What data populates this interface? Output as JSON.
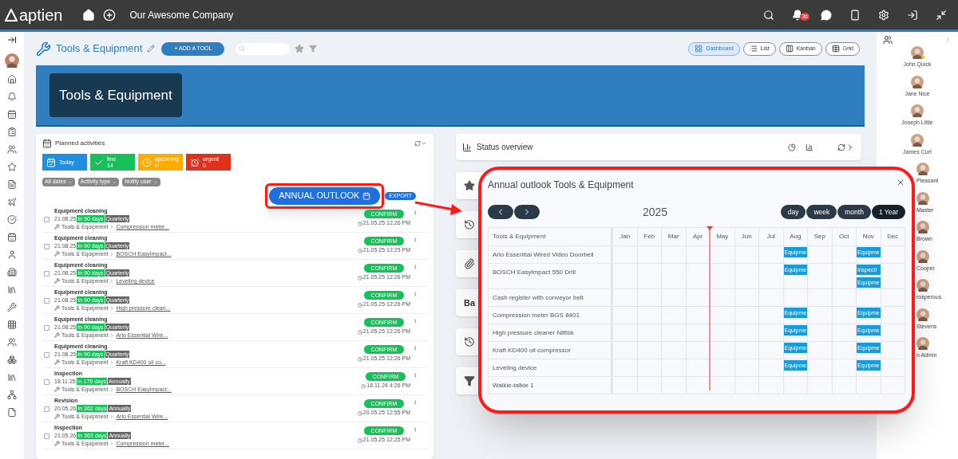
{
  "topbar": {
    "logo": "aptien",
    "company": "Our Awesome Company",
    "notifications": "36"
  },
  "header": {
    "title": "Tools & Equipment",
    "add_button": "+ ADD A TOOL",
    "views": [
      {
        "label": "Dashboard",
        "kind": "dashboard",
        "selected": true
      },
      {
        "label": "List",
        "kind": "list",
        "selected": false
      },
      {
        "label": "Kanban",
        "kind": "kanban",
        "selected": false
      },
      {
        "label": "Grid",
        "kind": "grid",
        "selected": false
      }
    ]
  },
  "banner": {
    "title": "Tools & Equipment"
  },
  "planned": {
    "title": "Planned activities",
    "tiles": [
      {
        "kind": "today",
        "label": "Today",
        "color": "#1e8fe1"
      },
      {
        "kind": "fine",
        "label": "fine",
        "count": "14",
        "color": "#16c15a"
      },
      {
        "kind": "upcoming",
        "label": "upcoming",
        "count": "0",
        "color": "#ffab00"
      },
      {
        "kind": "urgent",
        "label": "urgent",
        "count": "0",
        "color": "#e0301e"
      }
    ],
    "filters": [
      "All dates",
      "Activity type",
      "Notify user"
    ],
    "annual_button": "ANNUAL OUTLOOK",
    "export_button": "EXPORT",
    "activities": [
      {
        "title": "Equipment cleaning",
        "date": "21.08.25",
        "due": "In 90 days",
        "repeat": "Quarterly",
        "module": "Tools & Equipment",
        "item": "Compression meter...",
        "confirm": "CONFIRM",
        "stamp": "21.05.25 12:26 PM",
        "checked": false
      },
      {
        "title": "Equipment cleaning",
        "date": "21.08.25",
        "due": "In 90 days",
        "repeat": "Quarterly",
        "module": "Tools & Equipment",
        "item": "BOSCH EasyImpact...",
        "confirm": "CONFIRM",
        "stamp": "21.05.25 12:25 PM",
        "checked": false
      },
      {
        "title": "Equipment cleaning",
        "date": "21.08.25",
        "due": "In 90 days",
        "repeat": "Quarterly",
        "module": "Tools & Equipment",
        "item": "Leveling device",
        "confirm": "CONFIRM",
        "stamp": "21.05.25 12:26 PM",
        "checked": false
      },
      {
        "title": "Equipment cleaning",
        "date": "21.08.25",
        "due": "In 90 days",
        "repeat": "Quarterly",
        "module": "Tools & Equipment",
        "item": "High pressure clean...",
        "confirm": "CONFIRM",
        "stamp": "21.05.25 12:26 PM",
        "checked": false
      },
      {
        "title": "Equipment cleaning",
        "date": "21.08.25",
        "due": "In 90 days",
        "repeat": "Quarterly",
        "module": "Tools & Equipment",
        "item": "Arlo Essential Wire...",
        "confirm": "CONFIRM",
        "stamp": "21.05.25 12:26 PM",
        "checked": false
      },
      {
        "title": "Equipment cleaning",
        "date": "21.08.25",
        "due": "In 90 days",
        "repeat": "Quarterly",
        "module": "Tools & Equipment",
        "item": "Kraft KD400 oil co...",
        "confirm": "CONFIRM",
        "stamp": "21.05.25 12:26 PM",
        "checked": false
      },
      {
        "title": "Inspection",
        "date": "18.11.25",
        "due": "In 179 days",
        "repeat": "Annually",
        "module": "Tools & Equipment",
        "item": "BOSCH EasyImpact...",
        "confirm": "CONFIRM",
        "stamp": "18.11.24 4:26 PM",
        "checked": false
      },
      {
        "title": "Revision",
        "date": "20.05.26",
        "due": "In 362 days",
        "repeat": "Annually",
        "module": "Tools & Equipment",
        "item": "Arlo Essential Wire...",
        "confirm": "CONFIRM",
        "stamp": "20.05.25 12:55 PM",
        "checked": false
      },
      {
        "title": "Inspection",
        "date": "21.05.26",
        "due": "In 363 days",
        "repeat": "Annually",
        "module": "Tools & Equipment",
        "item": "Compression meter...",
        "confirm": "CONFIRM",
        "stamp": "21.05.25 12:25 PM",
        "checked": false
      }
    ]
  },
  "status": {
    "title": "Status overview"
  },
  "side_cards": [
    {
      "kind": "star"
    },
    {
      "kind": "history"
    },
    {
      "kind": "attachment"
    },
    {
      "kind": "text",
      "label": "Ba"
    },
    {
      "kind": "history"
    },
    {
      "kind": "filter"
    }
  ],
  "outlook": {
    "title": "Annual outlook Tools & Equipment",
    "year": "2025",
    "views": [
      {
        "label": "day",
        "selected": false
      },
      {
        "label": "week",
        "selected": false
      },
      {
        "label": "month",
        "selected": false
      },
      {
        "label": "1 Year",
        "selected": true
      }
    ],
    "header": "Tools & Equipment",
    "months": [
      "Jan",
      "Feb",
      "Mar",
      "Apr",
      "May",
      "Jun",
      "Jul",
      "Aug",
      "Sep",
      "Oct",
      "Nov",
      "Dec"
    ],
    "rows": [
      {
        "name": "Arlo Essential Wired Video Doorbell",
        "cells": [
          null,
          null,
          null,
          null,
          null,
          null,
          null,
          [
            "Equipme"
          ],
          null,
          null,
          [
            "Equipme"
          ],
          null
        ]
      },
      {
        "name": "BOSCH EasyImpact 550 Drill",
        "cells": [
          null,
          null,
          null,
          null,
          null,
          null,
          null,
          [
            "Equipme"
          ],
          null,
          null,
          [
            "Inspecti",
            "Equipme"
          ],
          null
        ]
      },
      {
        "name": "Cash register with conveyor belt",
        "cells": [
          null,
          null,
          null,
          null,
          null,
          null,
          null,
          null,
          null,
          null,
          null,
          null
        ]
      },
      {
        "name": "Compression meter BGS 8401",
        "cells": [
          null,
          null,
          null,
          null,
          null,
          null,
          null,
          [
            "Equipme"
          ],
          null,
          null,
          [
            "Equipme"
          ],
          null
        ]
      },
      {
        "name": "High pressure cleaner Nilfisk",
        "cells": [
          null,
          null,
          null,
          null,
          null,
          null,
          null,
          [
            "Equipme"
          ],
          null,
          null,
          [
            "Equipme"
          ],
          null
        ]
      },
      {
        "name": "Kraft KD400 oil compressor",
        "cells": [
          null,
          null,
          null,
          null,
          null,
          null,
          null,
          [
            "Equipme"
          ],
          null,
          null,
          [
            "Equipme"
          ],
          null
        ]
      },
      {
        "name": "Leveling device",
        "cells": [
          null,
          null,
          null,
          null,
          null,
          null,
          null,
          [
            "Equipme"
          ],
          null,
          null,
          [
            "Equipme"
          ],
          null
        ]
      },
      {
        "name": "Walkie-talkie 1",
        "cells": [
          null,
          null,
          null,
          null,
          null,
          null,
          null,
          null,
          null,
          null,
          null,
          null
        ]
      }
    ]
  },
  "people": [
    {
      "name": "John Quick",
      "kind": "full",
      "away": true
    },
    {
      "name": "Jane Nice",
      "kind": "full",
      "away": false
    },
    {
      "name": "Joseph Little",
      "kind": "full",
      "away": false
    },
    {
      "name": "James Curt",
      "kind": "full",
      "away": false
    },
    {
      "name": "Pleasant",
      "kind": "partial",
      "away": false
    },
    {
      "name": "Master",
      "kind": "partial",
      "away": false
    },
    {
      "name": "Brown",
      "kind": "partial",
      "away": false
    },
    {
      "name": "Cooper",
      "kind": "partial",
      "away": false
    },
    {
      "name": "rosperous",
      "kind": "partial",
      "away": false
    },
    {
      "name": "Stevens",
      "kind": "partial",
      "away": false
    },
    {
      "name": "n Admin",
      "kind": "partial",
      "away": false
    }
  ]
}
